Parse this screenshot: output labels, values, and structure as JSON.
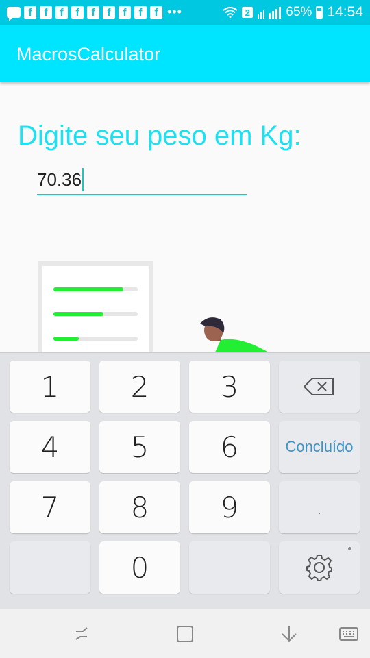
{
  "status_bar": {
    "battery": "65%",
    "time": "14:54",
    "sim_slot": "2",
    "notification_dots": "•••"
  },
  "app_bar": {
    "title": "MacrosCalculator"
  },
  "main": {
    "prompt": "Digite seu peso em Kg:",
    "weight_value": "70.36"
  },
  "keyboard": {
    "keys": [
      "1",
      "2",
      "3",
      "4",
      "5",
      "6",
      "7",
      "8",
      "9",
      "0"
    ],
    "done_label": "Concluído",
    "dot_label": "."
  },
  "colors": {
    "accent": "#00e5ff",
    "status_bar": "#00c8e0",
    "prompt_text": "#1ee0f0",
    "underline": "#1ec8b8",
    "done_text": "#3d94c6",
    "illustration_green": "#22ee33"
  },
  "icons": {
    "backspace": "backspace-icon",
    "settings": "gear-icon",
    "recent_apps": "recent-apps-icon",
    "home": "home-icon",
    "back": "back-icon",
    "keyboard": "keyboard-icon"
  }
}
